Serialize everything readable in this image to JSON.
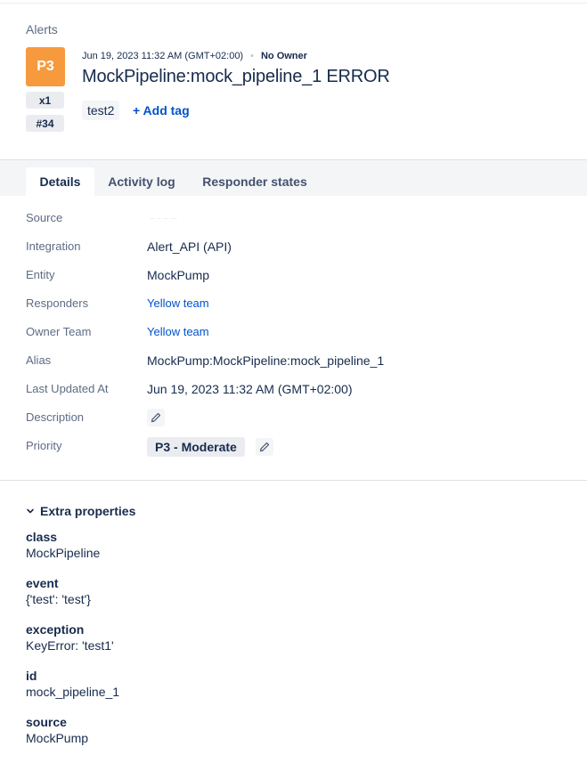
{
  "breadcrumb": "Alerts",
  "alert": {
    "priority": "P3",
    "priority_color": "#f79a3e",
    "count": "x1",
    "number": "#34",
    "created": "Jun 19, 2023 11:32 AM (GMT+02:00)",
    "owner": "No Owner",
    "title": "MockPipeline:mock_pipeline_1 ERROR",
    "tags": [
      "test2"
    ],
    "add_tag_label": "+ Add tag"
  },
  "tabs": [
    {
      "label": "Details",
      "active": true
    },
    {
      "label": "Activity log",
      "active": false
    },
    {
      "label": "Responder states",
      "active": false
    }
  ],
  "details": {
    "source": {
      "label": "Source",
      "value": "·· ·· ·· ···"
    },
    "integration": {
      "label": "Integration",
      "value": "Alert_API (API)"
    },
    "entity": {
      "label": "Entity",
      "value": "MockPump"
    },
    "responders": {
      "label": "Responders",
      "value": "Yellow team"
    },
    "owner_team": {
      "label": "Owner Team",
      "value": "Yellow team"
    },
    "alias": {
      "label": "Alias",
      "value": "MockPump:MockPipeline:mock_pipeline_1"
    },
    "last_updated": {
      "label": "Last Updated At",
      "value": "Jun 19, 2023 11:32 AM (GMT+02:00)"
    },
    "description": {
      "label": "Description",
      "edit_icon": "pencil-icon"
    },
    "priority": {
      "label": "Priority",
      "value": "P3 - Moderate",
      "edit_icon": "pencil-icon"
    }
  },
  "extra_properties": {
    "header": "Extra properties",
    "toggle_icon": "chevron-down-icon",
    "items": [
      {
        "key": "class",
        "value": "MockPipeline"
      },
      {
        "key": "event",
        "value": "{'test': 'test'}"
      },
      {
        "key": "exception",
        "value": "KeyError: 'test1'"
      },
      {
        "key": "id",
        "value": "mock_pipeline_1"
      },
      {
        "key": "source",
        "value": "MockPump"
      }
    ]
  },
  "colors": {
    "link": "#0052cc",
    "text": "#172b4d",
    "muted": "#5e6c84",
    "tab_bar_bg": "#f4f5f7"
  }
}
